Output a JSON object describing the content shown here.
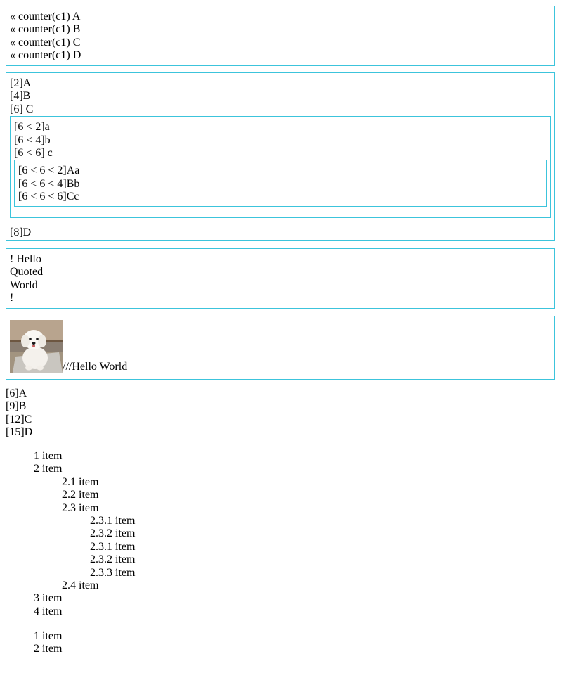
{
  "box1": {
    "lines": [
      "« counter(c1) A",
      "« counter(c1) B",
      "« counter(c1) C",
      "« counter(c1) D"
    ]
  },
  "box2": {
    "top_lines": [
      "[2]A",
      "[4]B",
      "[6] C"
    ],
    "inner1_lines": [
      "[6 < 2]a",
      "[6 < 4]b",
      "[6 < 6] c"
    ],
    "inner2_lines": [
      "[6 < 6 < 2]Aa",
      "[6 < 6 < 4]Bb",
      "[6 < 6 < 6]Cc"
    ],
    "last_line": "[8]D"
  },
  "box3": {
    "lines": [
      "! Hello",
      "Quoted",
      "World",
      "!"
    ]
  },
  "box4": {
    "image_name": "bichon-dog-photo",
    "text": "///Hello World"
  },
  "plain_list": [
    "[6]A",
    "[9]B",
    "[12]C",
    "[15]D"
  ],
  "nested_list": [
    {
      "level": 1,
      "text": "1 item"
    },
    {
      "level": 1,
      "text": "2 item"
    },
    {
      "level": 2,
      "text": "2.1 item"
    },
    {
      "level": 2,
      "text": "2.2 item"
    },
    {
      "level": 2,
      "text": "2.3 item"
    },
    {
      "level": 3,
      "text": "2.3.1 item"
    },
    {
      "level": 3,
      "text": "2.3.2 item"
    },
    {
      "level": 3,
      "text": "2.3.1 item"
    },
    {
      "level": 3,
      "text": "2.3.2 item"
    },
    {
      "level": 3,
      "text": "2.3.3 item"
    },
    {
      "level": 2,
      "text": "2.4 item"
    },
    {
      "level": 1,
      "text": "3 item"
    },
    {
      "level": 1,
      "text": "4 item"
    }
  ],
  "tail_list": [
    "1 item",
    "2 item"
  ],
  "colors": {
    "border": "#3cc4dc"
  }
}
